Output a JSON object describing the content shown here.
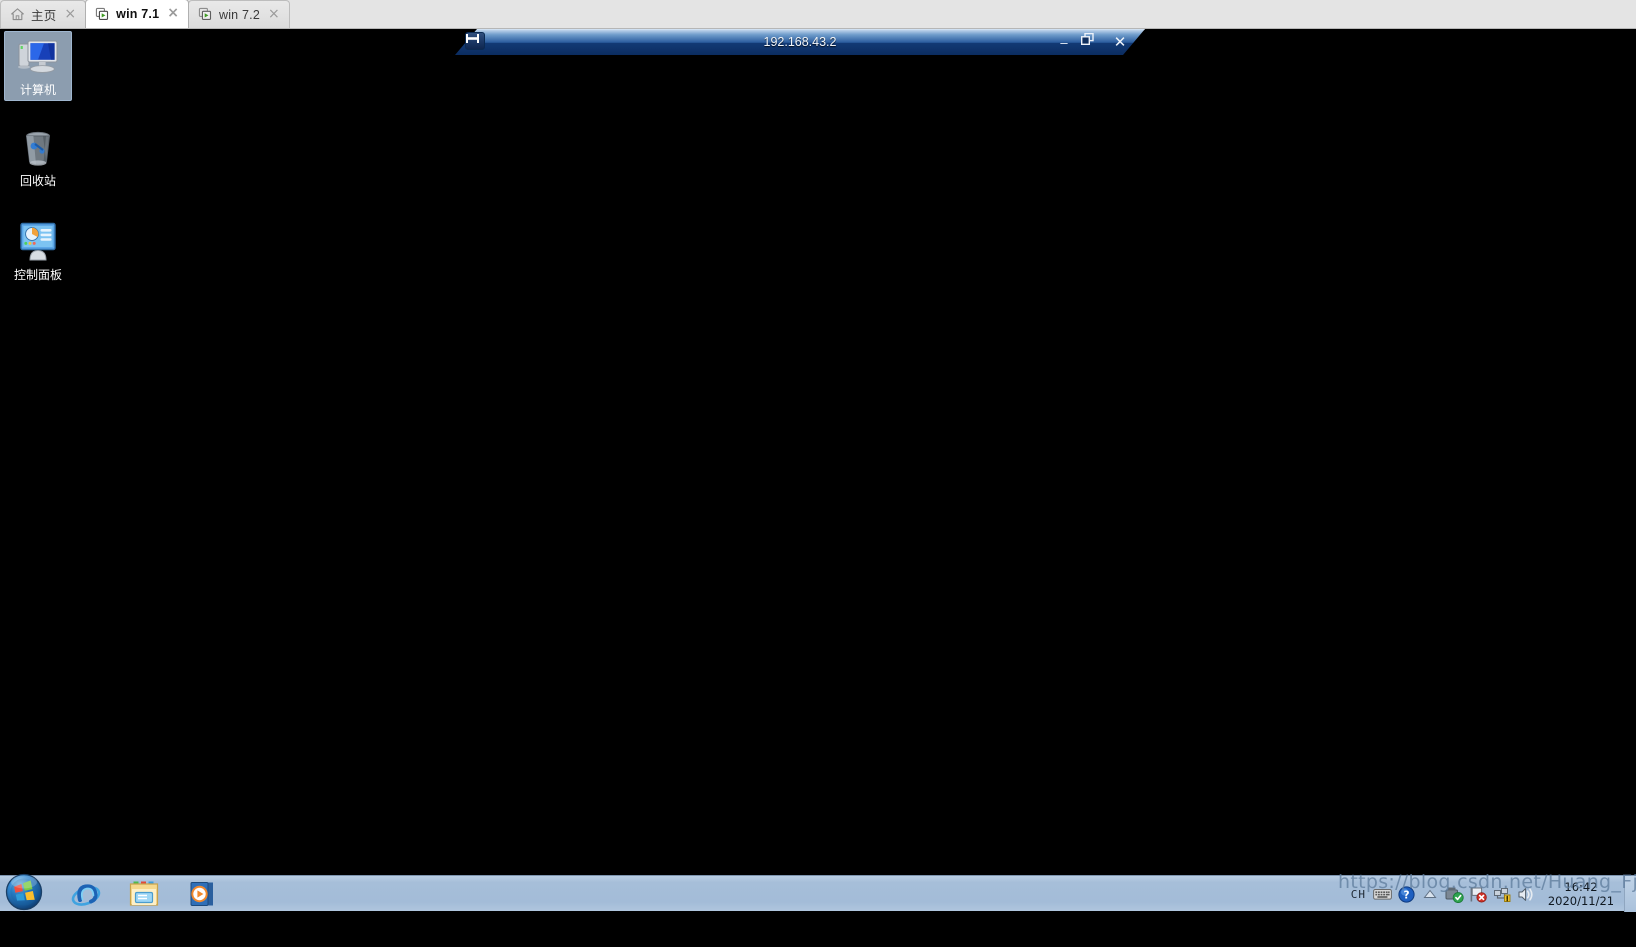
{
  "browser": {
    "tabs": [
      {
        "label": "主页",
        "icon": "home-icon",
        "active": false,
        "close_label": "×"
      },
      {
        "label": "win 7.1",
        "icon": "virtual-machine-icon",
        "active": true,
        "close_label": "×"
      },
      {
        "label": "win 7.2",
        "icon": "virtual-machine-icon",
        "active": false,
        "close_label": "×"
      }
    ]
  },
  "remote_window": {
    "title": "192.168.43.2",
    "pin_icon": "pin-icon",
    "minimize_label": "–",
    "restore_label": "❐",
    "close_label": "✕",
    "accent_color": "#1d4f96"
  },
  "desktop": {
    "background_color": "#000000",
    "icons": [
      {
        "name": "computer",
        "label": "计算机",
        "selected": true
      },
      {
        "name": "recycle-bin",
        "label": "回收站",
        "selected": false
      },
      {
        "name": "control-panel",
        "label": "控制面板",
        "selected": false
      }
    ]
  },
  "taskbar": {
    "start_label": "Start",
    "quick_launch": [
      {
        "name": "internet-explorer",
        "label": "Internet Explorer"
      },
      {
        "name": "windows-explorer",
        "label": "Windows Explorer"
      },
      {
        "name": "windows-media-player",
        "label": "Windows Media Player"
      }
    ],
    "tray": {
      "language_indicator": "CH",
      "icons": [
        {
          "name": "keyboard-icon"
        },
        {
          "name": "help-icon"
        },
        {
          "name": "show-hidden-icons-icon"
        },
        {
          "name": "removable-media-icon"
        },
        {
          "name": "action-center-flag-icon"
        },
        {
          "name": "network-icon"
        },
        {
          "name": "volume-icon"
        }
      ]
    },
    "clock": {
      "time": "16:42",
      "date": "2020/11/21"
    }
  },
  "watermark": {
    "text": "https://blog.csdn.net/Huang_Fj_im"
  }
}
